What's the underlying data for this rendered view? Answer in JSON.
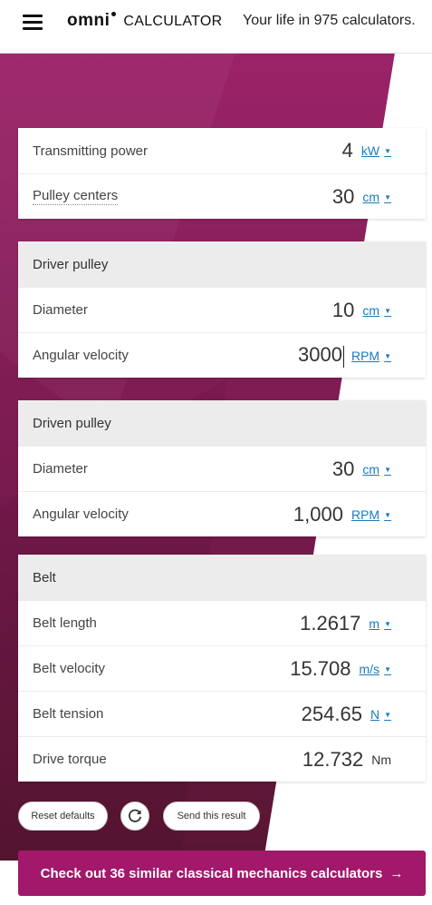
{
  "header": {
    "logo_main": "omni",
    "logo_sub": "CALCULATOR",
    "tagline": "Your life in 975 calculators."
  },
  "card_main": {
    "rows": [
      {
        "label": "Transmitting power",
        "value": "4",
        "unit": "kW"
      },
      {
        "label": "Pulley centers",
        "value": "30",
        "unit": "cm"
      }
    ]
  },
  "driver": {
    "title": "Driver pulley",
    "rows": [
      {
        "label": "Diameter",
        "value": "10",
        "unit": "cm"
      },
      {
        "label": "Angular velocity",
        "value": "3000",
        "unit": "RPM"
      }
    ]
  },
  "driven": {
    "title": "Driven pulley",
    "rows": [
      {
        "label": "Diameter",
        "value": "30",
        "unit": "cm"
      },
      {
        "label": "Angular velocity",
        "value": "1,000",
        "unit": "RPM"
      }
    ]
  },
  "belt": {
    "title": "Belt",
    "rows": [
      {
        "label": "Belt length",
        "value": "1.2617",
        "unit": "m"
      },
      {
        "label": "Belt velocity",
        "value": "15.708",
        "unit": "m/s"
      },
      {
        "label": "Belt tension",
        "value": "254.65",
        "unit": "N"
      },
      {
        "label": "Drive torque",
        "value": "12.732",
        "unit": "Nm"
      }
    ]
  },
  "actions": {
    "reset": "Reset defaults",
    "send": "Send this result"
  },
  "cta": {
    "label": "Check out 36 similar classical mechanics calculators",
    "arrow": "→"
  },
  "icons": {
    "menu": "hamburger-menu-icon",
    "reload": "reload-icon",
    "caret": "▼"
  },
  "colors": {
    "accent": "#a2186a",
    "link": "#1a7bbf",
    "bg_dark": "#6a1740",
    "bg_light": "#9b2368"
  }
}
